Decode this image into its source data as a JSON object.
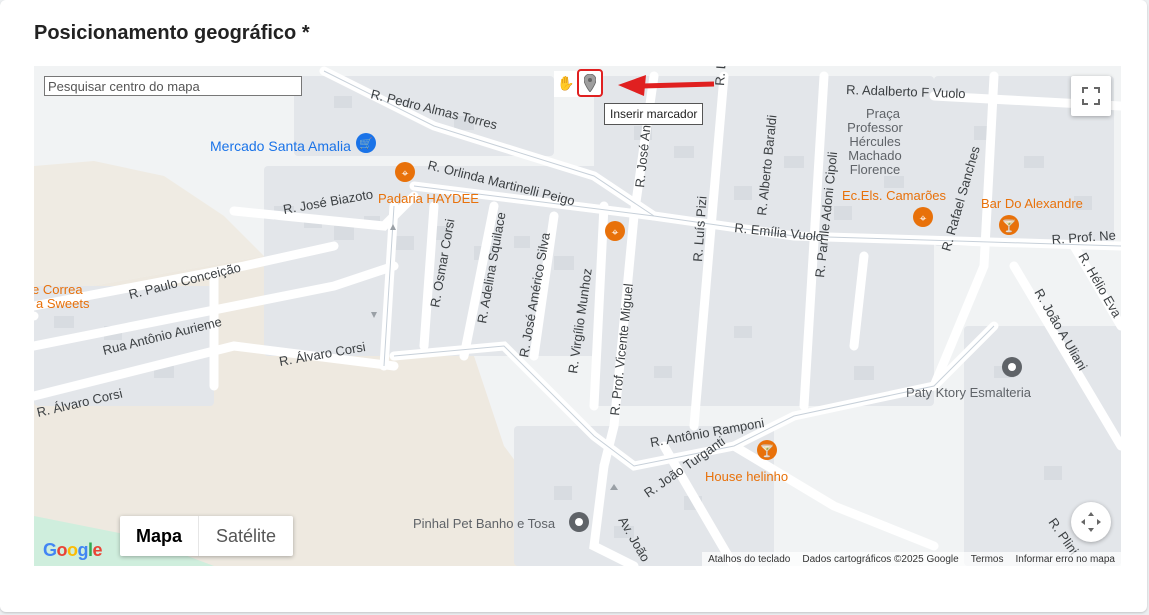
{
  "section": {
    "title": "Posicionamento geográfico *"
  },
  "map": {
    "search_placeholder": "Pesquisar centro do mapa",
    "tooltip": "Inserir marcador",
    "map_type": {
      "map_label": "Mapa",
      "satellite_label": "Satélite"
    },
    "logo": "Google",
    "attribution": {
      "shortcuts": "Atalhos do teclado",
      "data": "Dados cartográficos ©2025 Google",
      "terms": "Termos",
      "report": "Informar erro no mapa"
    },
    "streets": [
      "R. Pedro Almas Torres",
      "R. Orlinda Martinelli Peigo",
      "R. José Biazoto",
      "R. Paulo Conceição",
      "Rua Antônio Aurieme",
      "R. Álvaro Corsi",
      "R. Álvaro Corsi",
      "R. Osmar Corsi",
      "R. Adelina Squilace",
      "R. José Américo Silva",
      "R. Virgílio Munhoz",
      "R. Prof. Vicente Miguel",
      "R. José An",
      "R. Luís Pizi",
      "R. Lui",
      "R. Alberto Baraldi",
      "R. Parrile Adoni Cipoli",
      "R. Emília Vuolo",
      "R. Rafael Sanches",
      "R. Adalberto F Vuolo",
      "R. Prof. Ne",
      "R. Hélio Eva",
      "R. João A Uliani",
      "R. Antônio Ramponi",
      "R. João Turganti",
      "Av. João",
      "R. Plini"
    ],
    "places": [
      {
        "name": "Mercado Santa Amalia",
        "icon": "shopping-cart-icon",
        "color": "#1a73e8"
      },
      {
        "name": "Padaria HAYDEE",
        "icon": "restaurant-icon",
        "color": "#e8710a"
      },
      {
        "name": "Ec.Els. Camarões",
        "icon": "restaurant-icon",
        "color": "#e8710a"
      },
      {
        "name": "Bar Do Alexandre",
        "icon": "cocktail-icon",
        "color": "#e8710a"
      },
      {
        "name": "House helinho",
        "icon": "cocktail-icon",
        "color": "#e8710a"
      },
      {
        "name": "Paty Ktory Esmalteria",
        "icon": "place-icon",
        "color": "#5f6368"
      },
      {
        "name": "Pinhal Pet Banho e Tosa",
        "icon": "place-icon",
        "color": "#5f6368"
      }
    ],
    "area_labels": [
      "Praça",
      "Professor",
      "Hércules",
      "Machado",
      "Florence",
      "e Correa",
      "a Sweets"
    ]
  }
}
